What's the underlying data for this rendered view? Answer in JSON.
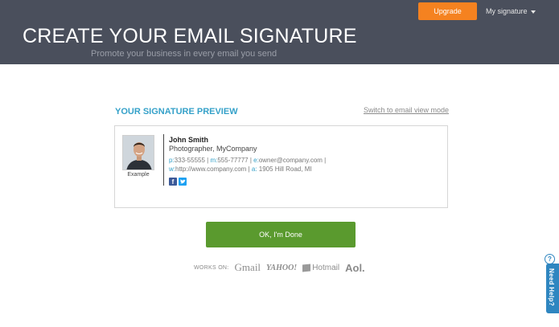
{
  "header": {
    "title": "CREATE YOUR EMAIL SIGNATURE",
    "subtitle": "Promote your business in every email you send",
    "upgrade_label": "Upgrade",
    "my_signature_label": "My signature"
  },
  "preview": {
    "heading": "YOUR SIGNATURE PREVIEW",
    "switch_link": "Switch to email view mode",
    "photo_caption": "Example",
    "name": "John Smith",
    "title": "Photographer, MyCompany",
    "line1": {
      "p_label": "p:",
      "phone": "333-55555",
      "m_label": "m:",
      "mobile": "555-77777",
      "e_label": "e:",
      "email": "owner@company.com"
    },
    "line2": {
      "w_label": "w:",
      "website": "http://www.company.com",
      "a_label": "a:",
      "address": "1905 Hill Road, MI"
    },
    "social_icons": [
      "facebook-icon",
      "twitter-icon"
    ]
  },
  "done_button": "OK, I'm Done",
  "works_on": {
    "label": "WORKS ON:",
    "logos": [
      "Gmail",
      "YAHOO!",
      "Hotmail",
      "Aol."
    ]
  },
  "help_tab": {
    "label": "Need Help?",
    "badge": "?"
  },
  "colors": {
    "header_bg": "#4a4f5c",
    "upgrade": "#f58220",
    "accent_blue": "#35a1c9",
    "done_green": "#5a9a2e",
    "help_blue": "#2f86c0"
  }
}
